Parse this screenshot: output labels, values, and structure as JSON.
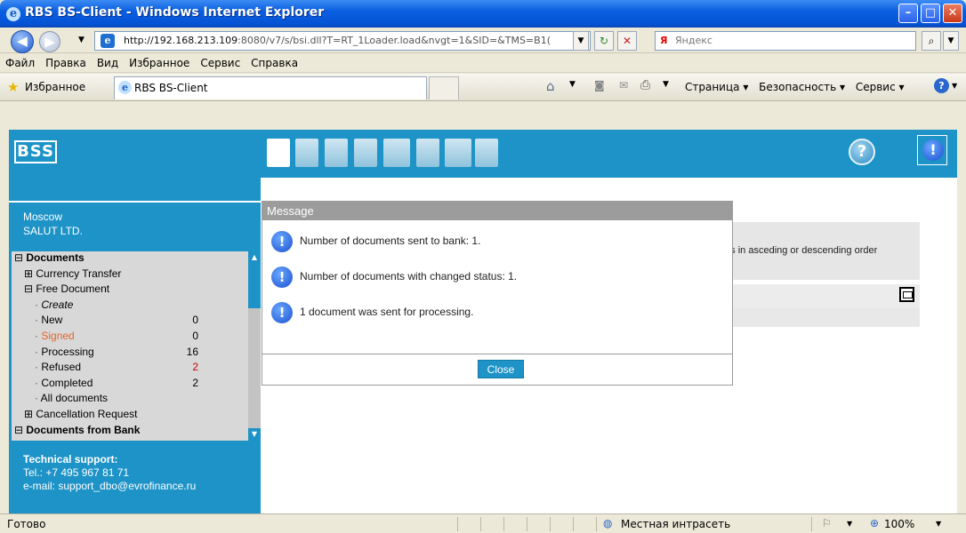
{
  "window": {
    "title": "RBS BS-Client - Windows Internet Explorer",
    "minimize": "–",
    "maximize": "□",
    "close": "✕"
  },
  "addressbar": {
    "url_host": "http://192.168.213.109",
    "url_rest": ":8080/v7/s/bsi.dll?T=RT_1Loader.load&nvgt=1&SID=&TMS=B1(",
    "search_placeholder": "Яндекс"
  },
  "menu": [
    "Файл",
    "Правка",
    "Вид",
    "Избранное",
    "Сервис",
    "Справка"
  ],
  "favbar": {
    "favorites": "Избранное",
    "tab_label": "RBS BS-Client",
    "commands": [
      "Страница ▾",
      "Безопасность ▾",
      "Сервис ▾"
    ]
  },
  "app": {
    "logo": "BSS",
    "help": "?",
    "alert": "!"
  },
  "sidebar": {
    "city": "Moscow",
    "company": "SALUT LTD.",
    "tree": [
      {
        "label": "Documents",
        "toggle": "⊟",
        "level": 0,
        "bold": true
      },
      {
        "label": "Currency Transfer",
        "toggle": "⊞",
        "level": 1
      },
      {
        "label": "Free Document",
        "toggle": "⊟",
        "level": 1
      },
      {
        "label": "Create",
        "level": 2,
        "italic": true
      },
      {
        "label": "New",
        "level": 2,
        "count": "0"
      },
      {
        "label": "Signed",
        "level": 2,
        "count": "0",
        "highlight": true
      },
      {
        "label": "Processing",
        "level": 2,
        "count": "16"
      },
      {
        "label": "Refused",
        "level": 2,
        "count": "2",
        "count_red": true
      },
      {
        "label": "Completed",
        "level": 2,
        "count": "2"
      },
      {
        "label": "All documents",
        "level": 2
      },
      {
        "label": "Cancellation Request",
        "toggle": "⊞",
        "level": 1
      },
      {
        "label": "Documents from Bank",
        "toggle": "⊟",
        "level": 0,
        "bold": true
      }
    ],
    "support_title": "Technical support:",
    "support_phone": "Tel.: +7 495 967 81 71",
    "support_email": "e-mail: support_dbo@evrofinance.ru"
  },
  "content": {
    "sort_hint": "nts in asceding or descending order"
  },
  "dialog": {
    "title": "Message",
    "messages": [
      "Number of documents sent to bank: 1.",
      "Number of documents with changed status: 1.",
      "1 document was sent for processing."
    ],
    "close_label": "Close"
  },
  "status": {
    "text": "Готово",
    "zone": "Местная интрасеть",
    "zoom": "100%"
  },
  "colors": {
    "app_blue": "#1d93c7",
    "signed_orange": "#e8632a",
    "refused_red": "#d00000"
  }
}
